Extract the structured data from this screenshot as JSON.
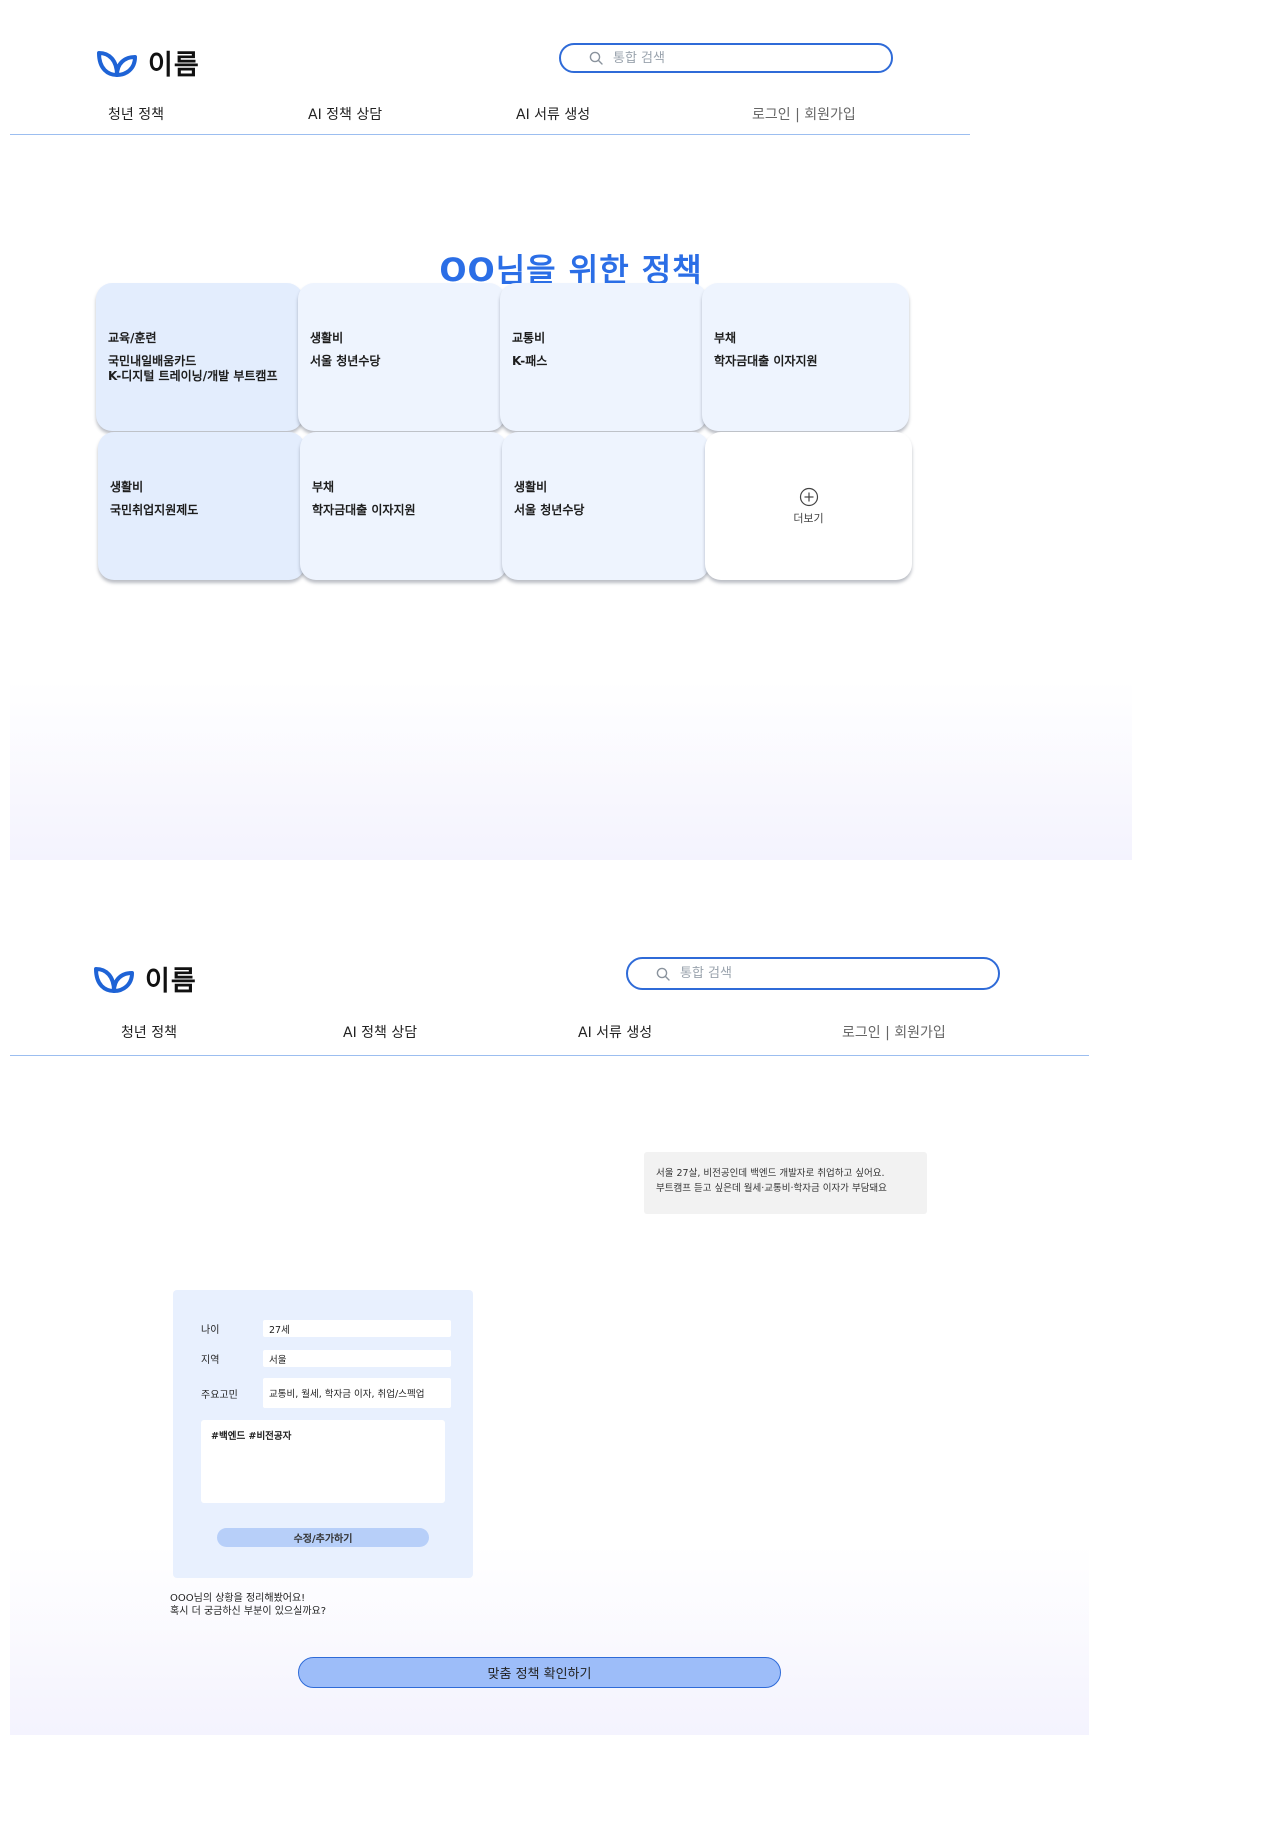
{
  "logo": {
    "text": "이름"
  },
  "search": {
    "placeholder": "통합 검색"
  },
  "nav": {
    "items": [
      {
        "label": "청년 정책"
      },
      {
        "label": "AI 정책 상담"
      },
      {
        "label": "AI 서류 생성"
      }
    ],
    "auth_label": "로그인 | 회원가입"
  },
  "colors": {
    "accent": "#2b6ee6",
    "divider": "#9cbef0",
    "card_bg": "#eef4fe",
    "card_bg_strong": "#e3edfd",
    "cta_bg": "#9dbdf9"
  },
  "recommend": {
    "title": "OO님을 위한 정책",
    "cards": [
      {
        "category": "교육/훈련",
        "title": "국민내일배움카드\nK-디지털 트레이닝/개발 부트캠프"
      },
      {
        "category": "생활비",
        "title": "서울 청년수당"
      },
      {
        "category": "교통비",
        "title": "K-패스"
      },
      {
        "category": "부채",
        "title": "학자금대출 이자지원"
      },
      {
        "category": "생활비",
        "title": "국민취업지원제도"
      },
      {
        "category": "부채",
        "title": "학자금대출 이자지원"
      },
      {
        "category": "생활비",
        "title": "서울 청년수당"
      }
    ],
    "more": {
      "icon": "plus-circle-icon",
      "label": "더보기"
    }
  },
  "chat": {
    "user_message": {
      "line1": "서울 27살, 비전공인데 백엔드 개발자로 취업하고 싶어요.",
      "line2": "부트캠프 듣고 싶은데 월세·교통비·학자금 이자가 부담돼요"
    },
    "profile": {
      "fields": [
        {
          "label": "나이",
          "value": "27세"
        },
        {
          "label": "지역",
          "value": "서울"
        },
        {
          "label": "주요고민",
          "value": "교통비, 월세, 학자금 이자, 취업/스펙업"
        }
      ],
      "tags": "#백엔드 #비전공자",
      "edit_button": "수정/추가하기"
    },
    "summary": {
      "line1": "OOO님의 상황을 정리해봤어요!",
      "line2": "혹시 더 궁금하신 부분이 있으실까요?"
    },
    "cta_button": "맞춤 정책 확인하기"
  }
}
